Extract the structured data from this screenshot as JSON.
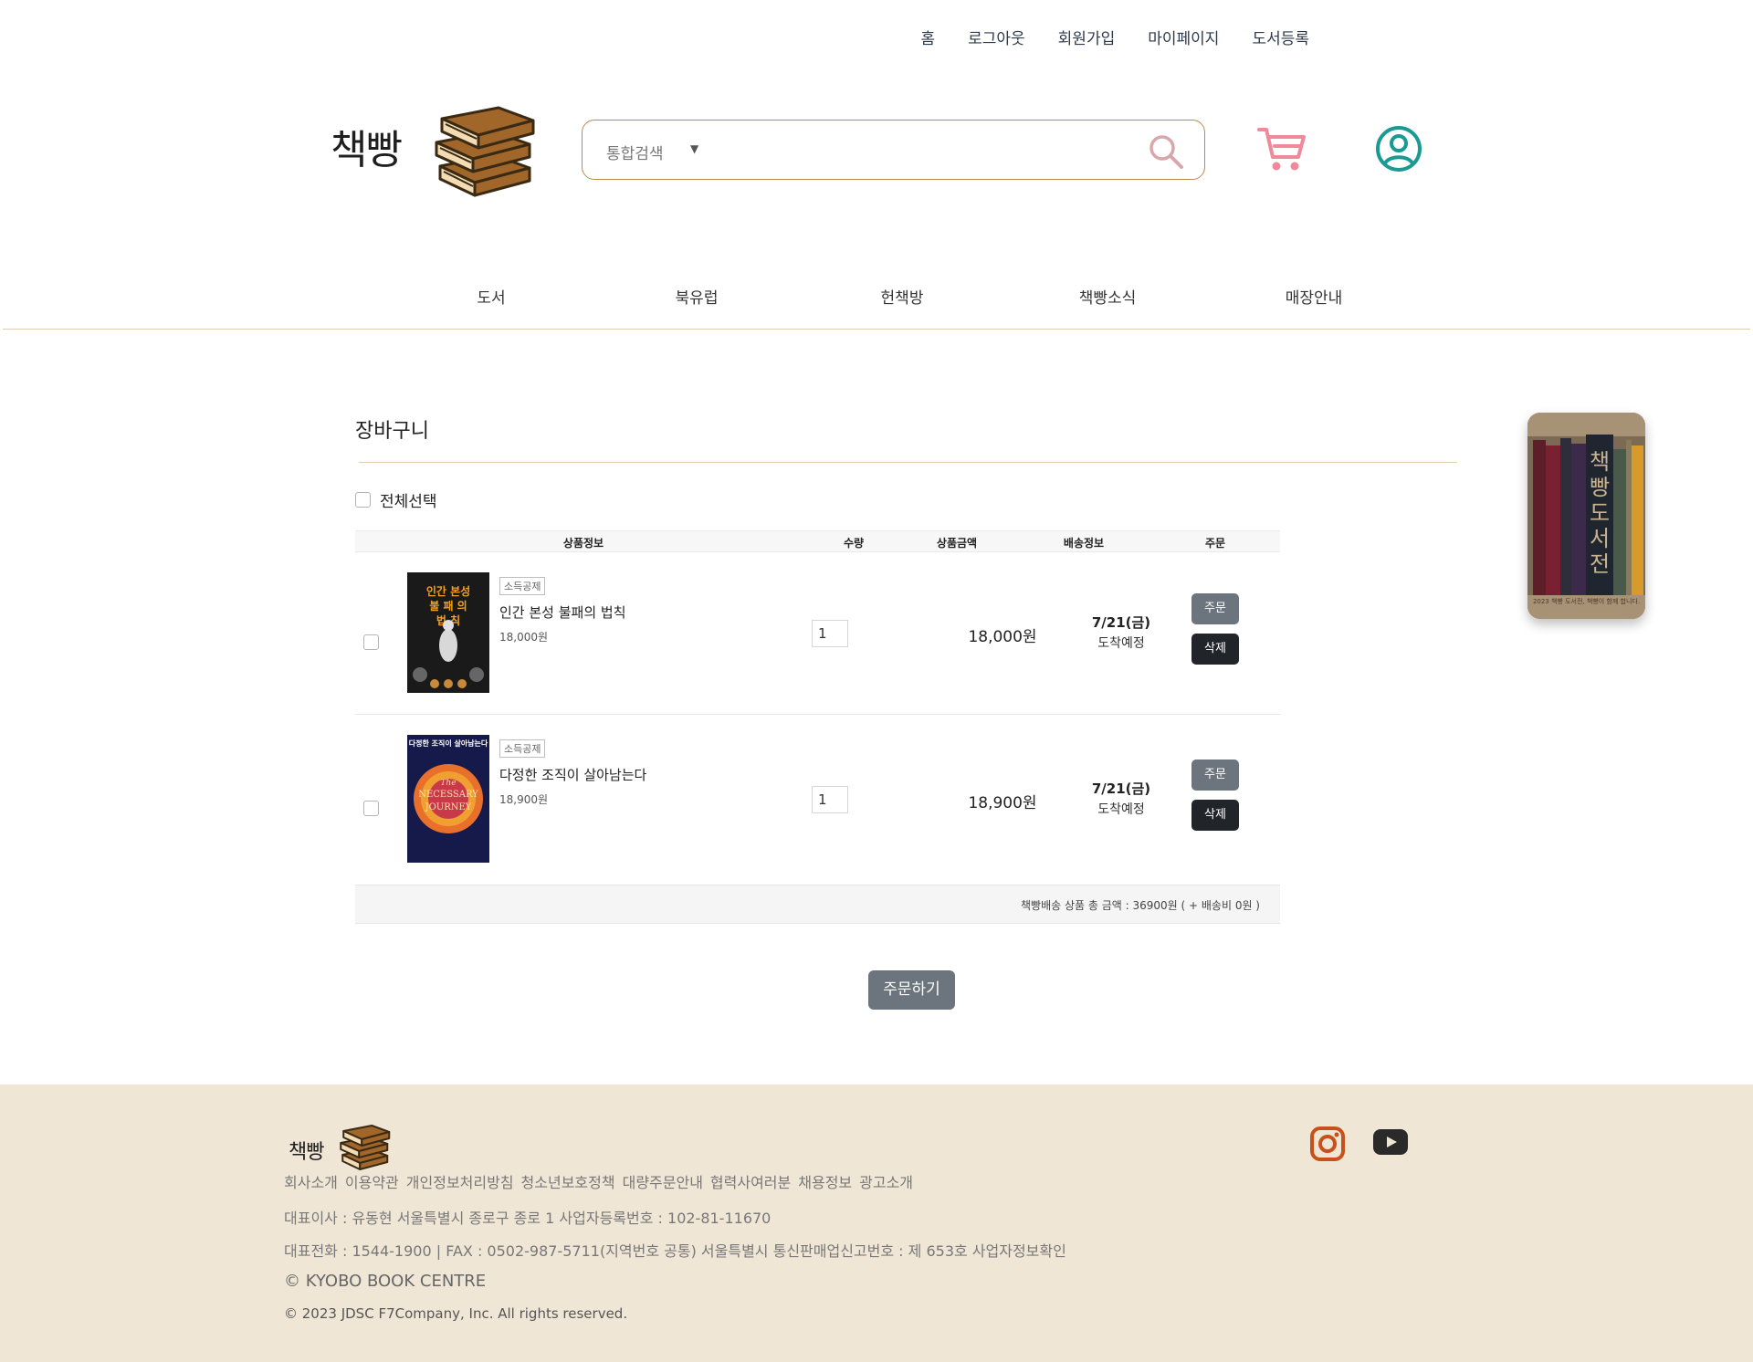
{
  "top_nav": [
    "홈",
    "로그아웃",
    "회원가입",
    "마이페이지",
    "도서등록"
  ],
  "header": {
    "logo_text": "책빵",
    "search": {
      "scope": "통합검색",
      "value": ""
    }
  },
  "main_nav": [
    "도서",
    "북유럽",
    "헌책방",
    "책빵소식",
    "매장안내"
  ],
  "side_banner": {
    "title": "책빵도서전",
    "caption": "2023 책빵 도서전, 책빵이 함께 합니다."
  },
  "cart": {
    "title": "장바구니",
    "select_all": "전체선택",
    "columns": [
      "상품정보",
      "수량",
      "상품금액",
      "배송정보",
      "주문"
    ],
    "items": [
      {
        "badge": "소득공제",
        "title": "인간 본성 불패의 법칙",
        "price": "18,000원",
        "quantity": "1",
        "amount": "18,000원",
        "ship_date": "7/21(금)",
        "ship_note": "도착예정",
        "order_label": "주문",
        "delete_label": "삭제",
        "cover_lines": [
          "인간 본성",
          "불 패 의",
          "법 칙"
        ]
      },
      {
        "badge": "소득공제",
        "title": "다정한 조직이 살아남는다",
        "price": "18,900원",
        "quantity": "1",
        "amount": "18,900원",
        "ship_date": "7/21(금)",
        "ship_note": "도착예정",
        "order_label": "주문",
        "delete_label": "삭제",
        "cover_lines": [
          "다정한 조직이 살아남는다",
          "The",
          "NECESSARY",
          "JOURNEY"
        ]
      }
    ],
    "total_text": "책빵배송 상품 총 금액 : 36900원 ( + 배송비 0원 )",
    "checkout_label": "주문하기"
  },
  "footer": {
    "logo_text": "책빵",
    "links": [
      "회사소개",
      "이용약관",
      "개인정보처리방침",
      "청소년보호정책",
      "대량주문안내",
      "협력사여러분",
      "채용정보",
      "광고소개"
    ],
    "info_line1": "대표이사 : 유동현 서울특별시 종로구 종로 1 사업자등록번호 : 102-81-11670",
    "info_line2": "대표전화 : 1544-1900 | FAX : 0502-987-5711(지역번호 공통) 서울특별시 통신판매업신고번호 : 제 653호 사업자정보확인",
    "brand": "© KYOBO BOOK CENTRE",
    "copyright": "© 2023 JDSC F7Company, Inc. All rights reserved."
  },
  "colors": {
    "accent_border": "#b98c4d",
    "cart_icon": "#f08a9a",
    "user_icon": "#1a9a93",
    "footer_bg": "#f0e6d6",
    "secondary_btn": "#6c757d",
    "dark_btn": "#212529",
    "instagram": "#c8511b"
  },
  "icons": {
    "search": "search-icon",
    "cart": "cart-icon",
    "user": "user-circle-icon",
    "instagram": "instagram-icon",
    "youtube": "youtube-icon",
    "caret": "caret-down-icon"
  }
}
